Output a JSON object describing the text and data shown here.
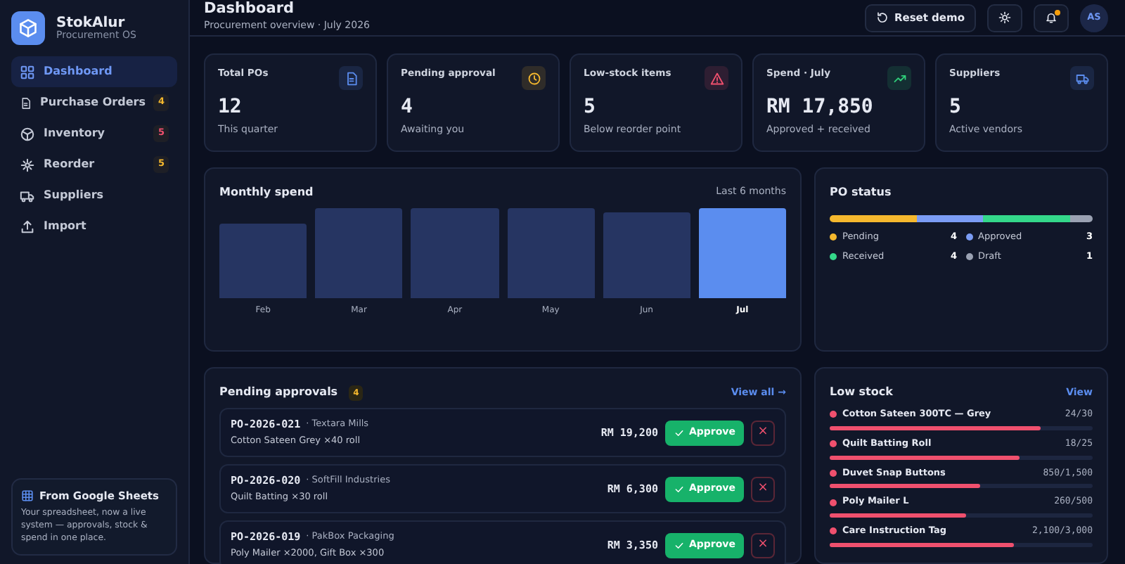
{
  "brand": {
    "name": "StokAlur",
    "tagline": "Procurement OS"
  },
  "sidebar": {
    "items": [
      {
        "label": "Dashboard",
        "selected": true
      },
      {
        "label": "Purchase Orders",
        "selected": false,
        "badge": "4",
        "color": "#f5b82e"
      },
      {
        "label": "Inventory",
        "selected": false,
        "badge": "5",
        "color": "#f0506e"
      },
      {
        "label": "Reorder",
        "selected": false,
        "badge": "5",
        "color": "#f5b82e"
      },
      {
        "label": "Suppliers",
        "selected": false
      },
      {
        "label": "Import",
        "selected": false
      }
    ],
    "promo": {
      "title": "From Google Sheets",
      "text": "Your spreadsheet, now a live system — approvals, stock & spend in one place."
    }
  },
  "header": {
    "title": "Dashboard",
    "subtitle": "Procurement overview · July 2026",
    "reset_button": "Reset demo",
    "avatar": "AS",
    "notification_dot": true
  },
  "stats": [
    {
      "label": "Total POs",
      "value": "12",
      "note": "This quarter",
      "color": "#5b8def"
    },
    {
      "label": "Pending approval",
      "value": "4",
      "note": "Awaiting you",
      "color": "#f5b82e"
    },
    {
      "label": "Low-stock items",
      "value": "5",
      "note": "Below reorder point",
      "color": "#f0506e"
    },
    {
      "label": "Spend · July",
      "value": "RM 17,850",
      "note": "Approved + received",
      "color": "#2fcf7a"
    },
    {
      "label": "Suppliers",
      "value": "5",
      "note": "Active vendors",
      "color": "#5b8def"
    }
  ],
  "monthly_spend": {
    "title": "Monthly spend",
    "range": "Last 6 months",
    "bars": [
      {
        "label": "Feb",
        "selected": false
      },
      {
        "label": "Mar",
        "selected": false
      },
      {
        "label": "Apr",
        "selected": false
      },
      {
        "label": "May",
        "selected": false
      },
      {
        "label": "Jun",
        "selected": false
      },
      {
        "label": "Jul",
        "selected": true
      }
    ]
  },
  "po_status": {
    "title": "PO status",
    "statuses": [
      {
        "label": "Pending",
        "count": "4",
        "color": "#f5b82e"
      },
      {
        "label": "Approved",
        "count": "3",
        "color": "#7b9cf5"
      },
      {
        "label": "Received",
        "count": "4",
        "color": "#34d88a"
      },
      {
        "label": "Draft",
        "count": "1",
        "color": "#9aa1b2"
      }
    ]
  },
  "pending_approvals": {
    "title": "Pending approvals",
    "count": "4",
    "view_all": "View all →",
    "rows": [
      {
        "po": "PO-2026-021",
        "supplier": "· Textara Mills",
        "items": "Cotton Sateen Grey ×40 roll",
        "amount": "RM 19,200",
        "approve": "Approve",
        "reject": "×"
      },
      {
        "po": "PO-2026-020",
        "supplier": "· SoftFill Industries",
        "items": "Quilt Batting ×30 roll",
        "amount": "RM 6,300",
        "approve": "Approve",
        "reject": "×"
      },
      {
        "po": "PO-2026-019",
        "supplier": "· PakBox Packaging",
        "items": "Poly Mailer ×2000, Gift Box ×300",
        "amount": "RM 3,350",
        "approve": "Approve",
        "reject": "×"
      }
    ]
  },
  "low_stock": {
    "title": "Low stock",
    "view": "View",
    "items": [
      {
        "name": "Cotton Sateen 300TC — Grey",
        "qty": "24/30",
        "level": 0.8
      },
      {
        "name": "Quilt Batting Roll",
        "qty": "18/25",
        "level": 0.72
      },
      {
        "name": "Duvet Snap Buttons",
        "qty": "850/1,500",
        "level": 0.57
      },
      {
        "name": "Poly Mailer L",
        "qty": "260/500",
        "level": 0.52
      },
      {
        "name": "Care Instruction Tag",
        "qty": "2,100/3,000",
        "level": 0.7
      }
    ]
  }
}
